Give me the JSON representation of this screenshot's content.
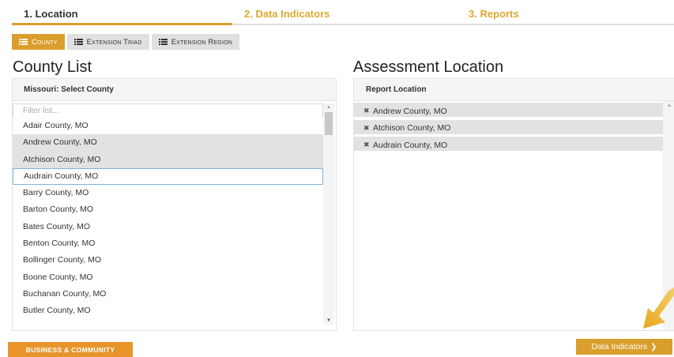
{
  "steps": [
    {
      "label": "1. Location",
      "active": true
    },
    {
      "label": "2. Data Indicators",
      "active": false
    },
    {
      "label": "3. Reports",
      "active": false
    }
  ],
  "type_tabs": [
    {
      "label": "County",
      "active": true,
      "icon": "list-icon"
    },
    {
      "label": "Extension Triad",
      "active": false,
      "icon": "list-icon"
    },
    {
      "label": "Extension Region",
      "active": false,
      "icon": "list-icon"
    }
  ],
  "county_list": {
    "title": "County List",
    "header": "Missouri: Select County",
    "filter_placeholder": "Filter list...",
    "items": [
      {
        "label": "Adair County, MO",
        "state": "normal"
      },
      {
        "label": "Andrew County, MO",
        "state": "selected"
      },
      {
        "label": "Atchison County, MO",
        "state": "selected"
      },
      {
        "label": "Audrain County, MO",
        "state": "focused"
      },
      {
        "label": "Barry County, MO",
        "state": "normal"
      },
      {
        "label": "Barton County, MO",
        "state": "normal"
      },
      {
        "label": "Bates County, MO",
        "state": "normal"
      },
      {
        "label": "Benton County, MO",
        "state": "normal"
      },
      {
        "label": "Bollinger County, MO",
        "state": "normal"
      },
      {
        "label": "Boone County, MO",
        "state": "normal"
      },
      {
        "label": "Buchanan County, MO",
        "state": "normal"
      },
      {
        "label": "Butler County, MO",
        "state": "normal"
      }
    ]
  },
  "assessment": {
    "title": "Assessment Location",
    "header": "Report Location",
    "items": [
      "Andrew County, MO",
      "Atchison County, MO",
      "Audrain County, MO"
    ]
  },
  "buttons": {
    "business": "BUSINESS & COMMUNITY",
    "next": "Data Indicators"
  },
  "colors": {
    "accent": "#d99e2b",
    "orange_button": "#e8942b",
    "selected_row": "#e2e2e2",
    "focus_border": "#7fb2de"
  }
}
